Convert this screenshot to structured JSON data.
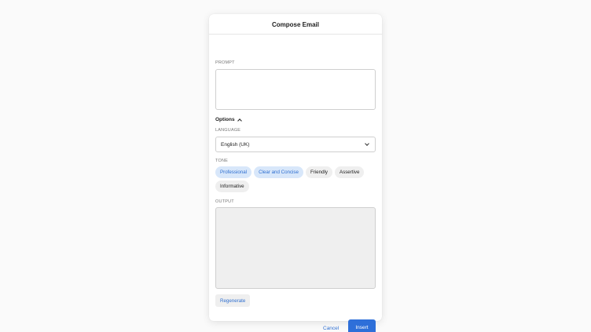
{
  "dialog": {
    "title": "Compose Email",
    "prompt_label": "PROMPT",
    "prompt_value": "",
    "options_label": "Options",
    "language_label": "LANGUAGE",
    "language_value": "English (UK)",
    "tone_label": "TONE",
    "tones": [
      {
        "label": "Professional",
        "selected": true
      },
      {
        "label": "Clear and Concise",
        "selected": true
      },
      {
        "label": "Friendly",
        "selected": false
      },
      {
        "label": "Assertive",
        "selected": false
      },
      {
        "label": "Informative",
        "selected": false
      }
    ],
    "output_label": "OUTPUT",
    "output_value": "",
    "regenerate_label": "Regenerate",
    "cancel_label": "Cancel",
    "insert_label": "Insert"
  },
  "colors": {
    "accent": "#2e6fd9",
    "chip_selected_bg": "#d8e7fa",
    "chip_bg": "#efefef"
  },
  "icons": {
    "options_toggle": "chevron-up-icon",
    "language_dropdown": "chevron-down-icon"
  }
}
